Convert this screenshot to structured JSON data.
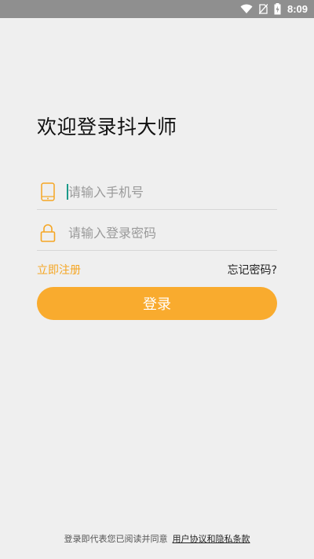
{
  "status_bar": {
    "time": "8:09",
    "icons": [
      "wifi-icon",
      "no-sim-icon",
      "battery-charging-icon"
    ]
  },
  "title": "欢迎登录抖大师",
  "phone_field": {
    "placeholder": "请输入手机号",
    "icon": "phone-icon",
    "value": ""
  },
  "password_field": {
    "placeholder": "请输入登录密码",
    "icon": "lock-icon",
    "value": ""
  },
  "links": {
    "register": "立即注册",
    "forgot_password": "忘记密码?"
  },
  "login_button": {
    "label": "登录"
  },
  "footer": {
    "text": "登录即代表您已阅读并同意",
    "agreement_link": "用户协议和隐私条款"
  },
  "colors": {
    "accent": "#f9ab2e",
    "link": "#f5a623",
    "background": "#efefef",
    "statusbar": "#8f8f8f"
  }
}
